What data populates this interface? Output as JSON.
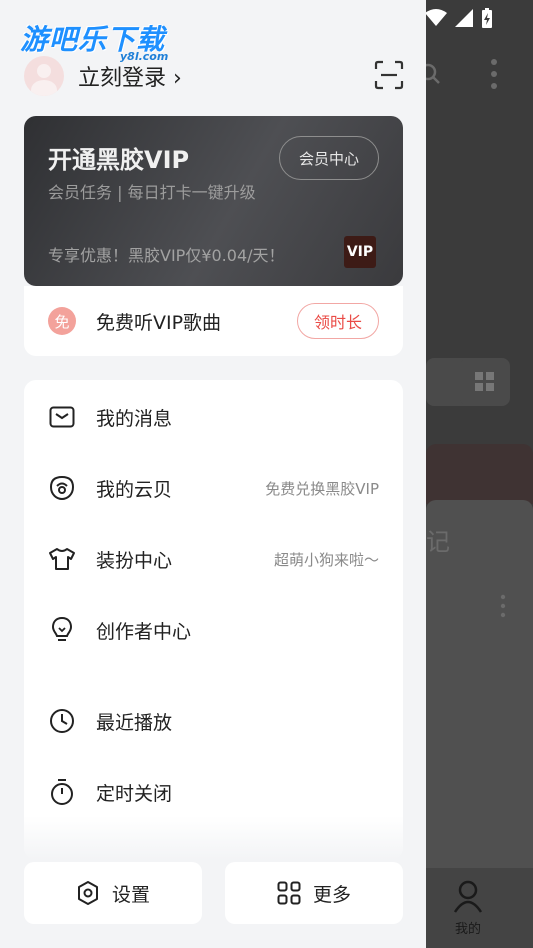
{
  "watermark": {
    "main": "游吧乐下载",
    "sub": "y8l.com"
  },
  "login": {
    "label": "立刻登录 ›"
  },
  "vip_card": {
    "title": "开通黑胶VIP",
    "subtitle": "会员任务 | 每日打卡一键升级",
    "center_button": "会员中心",
    "promo": "专享优惠！黑胶VIP仅¥0.04/天！",
    "badge": "VIP"
  },
  "free_card": {
    "icon_text": "免",
    "label": "免费听VIP歌曲",
    "button": "领时长"
  },
  "menu": {
    "items": [
      {
        "label": "我的消息",
        "hint": ""
      },
      {
        "label": "我的云贝",
        "hint": "免费兑换黑胶VIP"
      },
      {
        "label": "装扮中心",
        "hint": "超萌小狗来啦～"
      },
      {
        "label": "创作者中心",
        "hint": ""
      },
      {
        "label": "最近播放",
        "hint": ""
      },
      {
        "label": "定时关闭",
        "hint": ""
      }
    ]
  },
  "bottom": {
    "settings": "设置",
    "more": "更多"
  },
  "background": {
    "partial_text": "记",
    "tab_me": "我的"
  },
  "colors": {
    "accent_red": "#ea4b46",
    "vip_dark": "#3a3a3d",
    "drawer_bg": "#f3f4f6"
  }
}
